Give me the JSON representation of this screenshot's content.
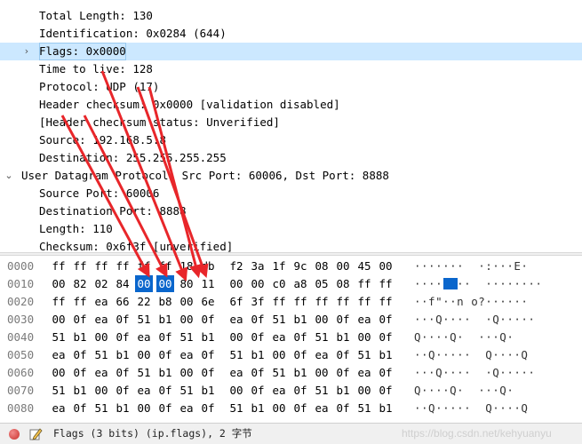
{
  "tree": {
    "rows": [
      {
        "text": "Total Length: 130",
        "indent": 2,
        "expander": ""
      },
      {
        "text": "Identification: 0x0284 (644)",
        "indent": 2,
        "expander": ""
      },
      {
        "text": "Flags: 0x0000",
        "indent": 2,
        "expander": "›",
        "selected": true
      },
      {
        "text": "Time to live: 128",
        "indent": 2,
        "expander": ""
      },
      {
        "text": "Protocol: UDP (17)",
        "indent": 2,
        "expander": ""
      },
      {
        "text": "Header checksum: 0x0000 [validation disabled]",
        "indent": 2,
        "expander": ""
      },
      {
        "text": "[Header checksum status: Unverified]",
        "indent": 2,
        "expander": ""
      },
      {
        "text": "Source: 192.168.5.8",
        "indent": 2,
        "expander": ""
      },
      {
        "text": "Destination: 255.255.255.255",
        "indent": 2,
        "expander": ""
      },
      {
        "text": "User Datagram Protocol, Src Port: 60006, Dst Port: 8888",
        "indent": 1,
        "expander": "⌄"
      },
      {
        "text": "Source Port: 60006",
        "indent": 2,
        "expander": ""
      },
      {
        "text": "Destination Port: 8888",
        "indent": 2,
        "expander": ""
      },
      {
        "text": "Length: 110",
        "indent": 2,
        "expander": ""
      },
      {
        "text": "Checksum: 0x6f3f [unverified]",
        "indent": 2,
        "expander": ""
      }
    ]
  },
  "bytes": {
    "rows": [
      {
        "offset": "0000",
        "hex": [
          "ff",
          "ff",
          "ff",
          "ff",
          "ff",
          "ff",
          "18",
          "db",
          "f2",
          "3a",
          "1f",
          "9c",
          "08",
          "00",
          "45",
          "00"
        ],
        "ascii": "......··:··E·"
      },
      {
        "offset": "0010",
        "hex": [
          "00",
          "82",
          "02",
          "84",
          "00",
          "00",
          "80",
          "11",
          "00",
          "00",
          "c0",
          "a8",
          "05",
          "08",
          "ff",
          "ff"
        ],
        "ascii": "····························"
      },
      {
        "offset": "0020",
        "hex": [
          "ff",
          "ff",
          "ea",
          "66",
          "22",
          "b8",
          "00",
          "6e",
          "6f",
          "3f",
          "ff",
          "ff",
          "ff",
          "ff",
          "ff",
          "ff"
        ],
        "ascii": ""
      },
      {
        "offset": "0030",
        "hex": [
          "00",
          "0f",
          "ea",
          "0f",
          "51",
          "b1",
          "00",
          "0f",
          "ea",
          "0f",
          "51",
          "b1",
          "00",
          "0f",
          "ea",
          "0f"
        ],
        "ascii": ""
      },
      {
        "offset": "0040",
        "hex": [
          "51",
          "b1",
          "00",
          "0f",
          "ea",
          "0f",
          "51",
          "b1",
          "00",
          "0f",
          "ea",
          "0f",
          "51",
          "b1",
          "00",
          "0f"
        ],
        "ascii": ""
      },
      {
        "offset": "0050",
        "hex": [
          "ea",
          "0f",
          "51",
          "b1",
          "00",
          "0f",
          "ea",
          "0f",
          "51",
          "b1",
          "00",
          "0f",
          "ea",
          "0f",
          "51",
          "b1"
        ],
        "ascii": ""
      },
      {
        "offset": "0060",
        "hex": [
          "00",
          "0f",
          "ea",
          "0f",
          "51",
          "b1",
          "00",
          "0f",
          "ea",
          "0f",
          "51",
          "b1",
          "00",
          "0f",
          "ea",
          "0f"
        ],
        "ascii": ""
      },
      {
        "offset": "0070",
        "hex": [
          "51",
          "b1",
          "00",
          "0f",
          "ea",
          "0f",
          "51",
          "b1",
          "00",
          "0f",
          "ea",
          "0f",
          "51",
          "b1",
          "00",
          "0f"
        ],
        "ascii": ""
      },
      {
        "offset": "0080",
        "hex": [
          "ea",
          "0f",
          "51",
          "b1",
          "00",
          "0f",
          "ea",
          "0f",
          "51",
          "b1",
          "00",
          "0f",
          "ea",
          "0f",
          "51",
          "b1"
        ],
        "ascii": ""
      }
    ],
    "ascii_rows": [
      "·······  ·:···E·",
      "····  ··  ········",
      "··f\"··n o?······",
      "···Q····  ·Q·····",
      "Q····Q·  ···Q·",
      "··Q·····  Q····Q",
      "···Q····  ·Q·····",
      "Q····Q·  ···Q·",
      "··Q·····  Q····Q"
    ],
    "highlight": {
      "row": 1,
      "start": 4,
      "end": 5
    }
  },
  "status": {
    "text": "Flags (3 bits) (ip.flags), 2 字节",
    "watermark": "https://blog.csdn.net/kehyuanyu",
    "icons": [
      "status-indicator-icon",
      "edit-icon"
    ]
  },
  "colors": {
    "selection": "#cce8ff",
    "byte_highlight": "#0a66cc",
    "arrow": "#e8262a"
  }
}
